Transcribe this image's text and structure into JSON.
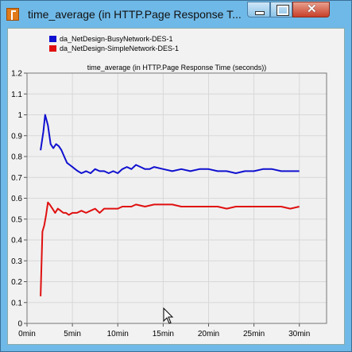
{
  "window": {
    "title": "time_average (in HTTP.Page Response T..."
  },
  "icons": {
    "app": "app-icon",
    "minimize": "minimize-icon",
    "maximize": "maximize-icon",
    "close": "close-icon"
  },
  "legend": [
    {
      "label": "da_NetDesign-BusyNetwork-DES-1",
      "color": "#1010d0"
    },
    {
      "label": "da_NetDesign-SimpleNetwork-DES-1",
      "color": "#e01010"
    }
  ],
  "chart_data": {
    "type": "line",
    "title": "time_average (in HTTP.Page Response Time (seconds))",
    "x_tick_labels": [
      "0min",
      "5min",
      "10min",
      "15min",
      "20min",
      "25min",
      "30min"
    ],
    "y_tick_labels": [
      "0",
      "0.1",
      "0.2",
      "0.3",
      "0.4",
      "0.5",
      "0.6",
      "0.7",
      "0.8",
      "0.9",
      "1",
      "1.1",
      "1.2"
    ],
    "xlim": [
      0,
      33
    ],
    "ylim": [
      0,
      1.2
    ],
    "grid": true,
    "legend_position": "top-left",
    "series": [
      {
        "name": "da_NetDesign-BusyNetwork-DES-1",
        "color": "#1010d0",
        "x": [
          1.5,
          1.8,
          2.0,
          2.3,
          2.6,
          2.9,
          3.2,
          3.5,
          3.8,
          4.1,
          4.4,
          4.7,
          5.0,
          5.3,
          5.6,
          6.0,
          6.5,
          7.0,
          7.5,
          8.0,
          8.5,
          9.0,
          9.5,
          10.0,
          10.5,
          11.0,
          11.5,
          12.0,
          12.5,
          13.0,
          13.5,
          14.0,
          15.0,
          16.0,
          17.0,
          18.0,
          19.0,
          20.0,
          21.0,
          22.0,
          23.0,
          24.0,
          25.0,
          26.0,
          27.0,
          28.0,
          29.0,
          30.0
        ],
        "values": [
          0.83,
          0.92,
          1.0,
          0.95,
          0.86,
          0.84,
          0.86,
          0.85,
          0.83,
          0.8,
          0.77,
          0.76,
          0.75,
          0.74,
          0.73,
          0.72,
          0.73,
          0.72,
          0.74,
          0.73,
          0.73,
          0.72,
          0.73,
          0.72,
          0.74,
          0.75,
          0.74,
          0.76,
          0.75,
          0.74,
          0.74,
          0.75,
          0.74,
          0.73,
          0.74,
          0.73,
          0.74,
          0.74,
          0.73,
          0.73,
          0.72,
          0.73,
          0.73,
          0.74,
          0.74,
          0.73,
          0.73,
          0.73
        ]
      },
      {
        "name": "da_NetDesign-SimpleNetwork-DES-1",
        "color": "#e01010",
        "x": [
          1.5,
          1.7,
          1.9,
          2.1,
          2.3,
          2.5,
          2.8,
          3.1,
          3.4,
          3.7,
          4.0,
          4.3,
          4.6,
          5.0,
          5.5,
          6.0,
          6.5,
          7.0,
          7.5,
          8.0,
          8.5,
          9.0,
          9.5,
          10.0,
          10.5,
          11.0,
          11.5,
          12.0,
          13.0,
          14.0,
          15.0,
          16.0,
          17.0,
          18.0,
          19.0,
          20.0,
          21.0,
          22.0,
          23.0,
          24.0,
          25.0,
          26.0,
          27.0,
          28.0,
          29.0,
          30.0
        ],
        "values": [
          0.13,
          0.44,
          0.47,
          0.52,
          0.58,
          0.57,
          0.55,
          0.53,
          0.55,
          0.54,
          0.53,
          0.53,
          0.52,
          0.53,
          0.53,
          0.54,
          0.53,
          0.54,
          0.55,
          0.53,
          0.55,
          0.55,
          0.55,
          0.55,
          0.56,
          0.56,
          0.56,
          0.57,
          0.56,
          0.57,
          0.57,
          0.57,
          0.56,
          0.56,
          0.56,
          0.56,
          0.56,
          0.55,
          0.56,
          0.56,
          0.56,
          0.56,
          0.56,
          0.56,
          0.55,
          0.56
        ]
      }
    ]
  }
}
